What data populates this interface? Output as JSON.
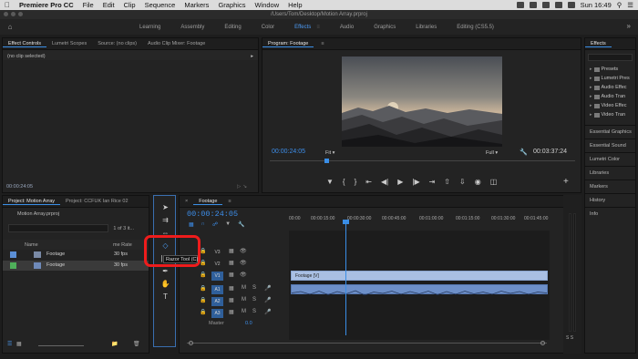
{
  "menubar": {
    "app": "Premiere Pro CC",
    "items": [
      "File",
      "Edit",
      "Clip",
      "Sequence",
      "Markers",
      "Graphics",
      "Window",
      "Help"
    ],
    "clock": "Sun 16:49"
  },
  "window": {
    "title": "/Users/Tom/Desktop/Motion Array.prproj"
  },
  "workspaces": [
    {
      "label": "Learning",
      "active": false
    },
    {
      "label": "Assembly",
      "active": false
    },
    {
      "label": "Editing",
      "active": false
    },
    {
      "label": "Color",
      "active": false
    },
    {
      "label": "Effects",
      "active": true
    },
    {
      "label": "Audio",
      "active": false
    },
    {
      "label": "Graphics",
      "active": false
    },
    {
      "label": "Libraries",
      "active": false
    },
    {
      "label": "Editing (CS5.5)",
      "active": false
    }
  ],
  "effect_controls": {
    "tabs": [
      "Effect Controls",
      "Lumetri Scopes",
      "Source: (no clips)",
      "Audio Clip Mixer: Footage"
    ],
    "no_clip": "(no clip selected)",
    "timecode": "00:00:24:05"
  },
  "program": {
    "tab": "Program: Footage",
    "timecode_left": "00:00:24:05",
    "fit": "Fit",
    "resolution": "Full",
    "timecode_right": "00:03:37:24"
  },
  "effects_panel": {
    "title": "Effects",
    "tree": [
      "Presets",
      "Lumetri Pres",
      "Audio Effec",
      "Audio Tran",
      "Video Effec",
      "Video Tran"
    ],
    "stacked_tabs": [
      "Essential Graphics",
      "Essential Sound",
      "Lumetri Color",
      "Libraries",
      "Markers",
      "History",
      "Info"
    ]
  },
  "project": {
    "tabs": [
      "Project: Motion Array",
      "Project: CCFUK Ian Rice 02"
    ],
    "file": "Motion Array.prproj",
    "count": "1 of 3 it...",
    "col_name": "Name",
    "col_rate": "me Rate",
    "rows": [
      {
        "name": "Footage",
        "fps": "30 fps",
        "swatch": "#5b8fd6"
      },
      {
        "name": "Footage",
        "fps": "30 fps",
        "swatch": "#4fb05a"
      }
    ]
  },
  "tools": {
    "tooltip": "Razor Tool (C)"
  },
  "timeline": {
    "tab": "Footage",
    "timecode": "00:00:24:05",
    "ruler": [
      "00:00",
      "00:00:15:00",
      "00:00:30:00",
      "00:00:45:00",
      "00:01:00:00",
      "00:01:15:00",
      "00:01:30:00",
      "00:01:45:00"
    ],
    "tracks": [
      "V3",
      "V2",
      "V1",
      "A1",
      "A2",
      "A3"
    ],
    "clip_label": "Footage [V]",
    "master": "Master",
    "master_value": "0.0"
  },
  "meter": {
    "label": "S S"
  }
}
